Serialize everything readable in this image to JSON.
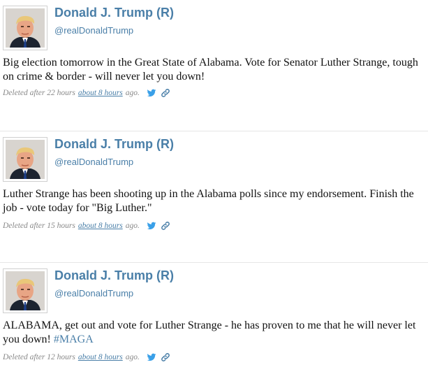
{
  "tweets": [
    {
      "name": "Donald J. Trump (R)",
      "handle": "@realDonaldTrump",
      "text": "Big election tomorrow in the Great State of Alabama. Vote for Senator Luther Strange, tough on crime & border - will never let you down!",
      "hashtag": "",
      "deleted_after": "Deleted after 22 hours",
      "ago_link": "about 8 hours",
      "ago_suffix": "ago."
    },
    {
      "name": "Donald J. Trump (R)",
      "handle": "@realDonaldTrump",
      "text": "Luther Strange has been shooting up in the Alabama polls since my endorsement. Finish the job - vote today for \"Big Luther.\"",
      "hashtag": "",
      "deleted_after": "Deleted after 15 hours",
      "ago_link": "about 8 hours",
      "ago_suffix": "ago."
    },
    {
      "name": "Donald J. Trump (R)",
      "handle": "@realDonaldTrump",
      "text": "ALABAMA, get out and vote for Luther Strange - he has proven to me that he will never let you down!",
      "hashtag": "#MAGA",
      "deleted_after": "Deleted after 12 hours",
      "ago_link": "about 8 hours",
      "ago_suffix": "ago."
    }
  ],
  "icons": {
    "twitter": "twitter-bird-icon",
    "link": "link-icon"
  },
  "colors": {
    "link": "#4a7fa8",
    "twitter_blue": "#3aa0e8",
    "meta_gray": "#888888",
    "text": "#111111"
  }
}
